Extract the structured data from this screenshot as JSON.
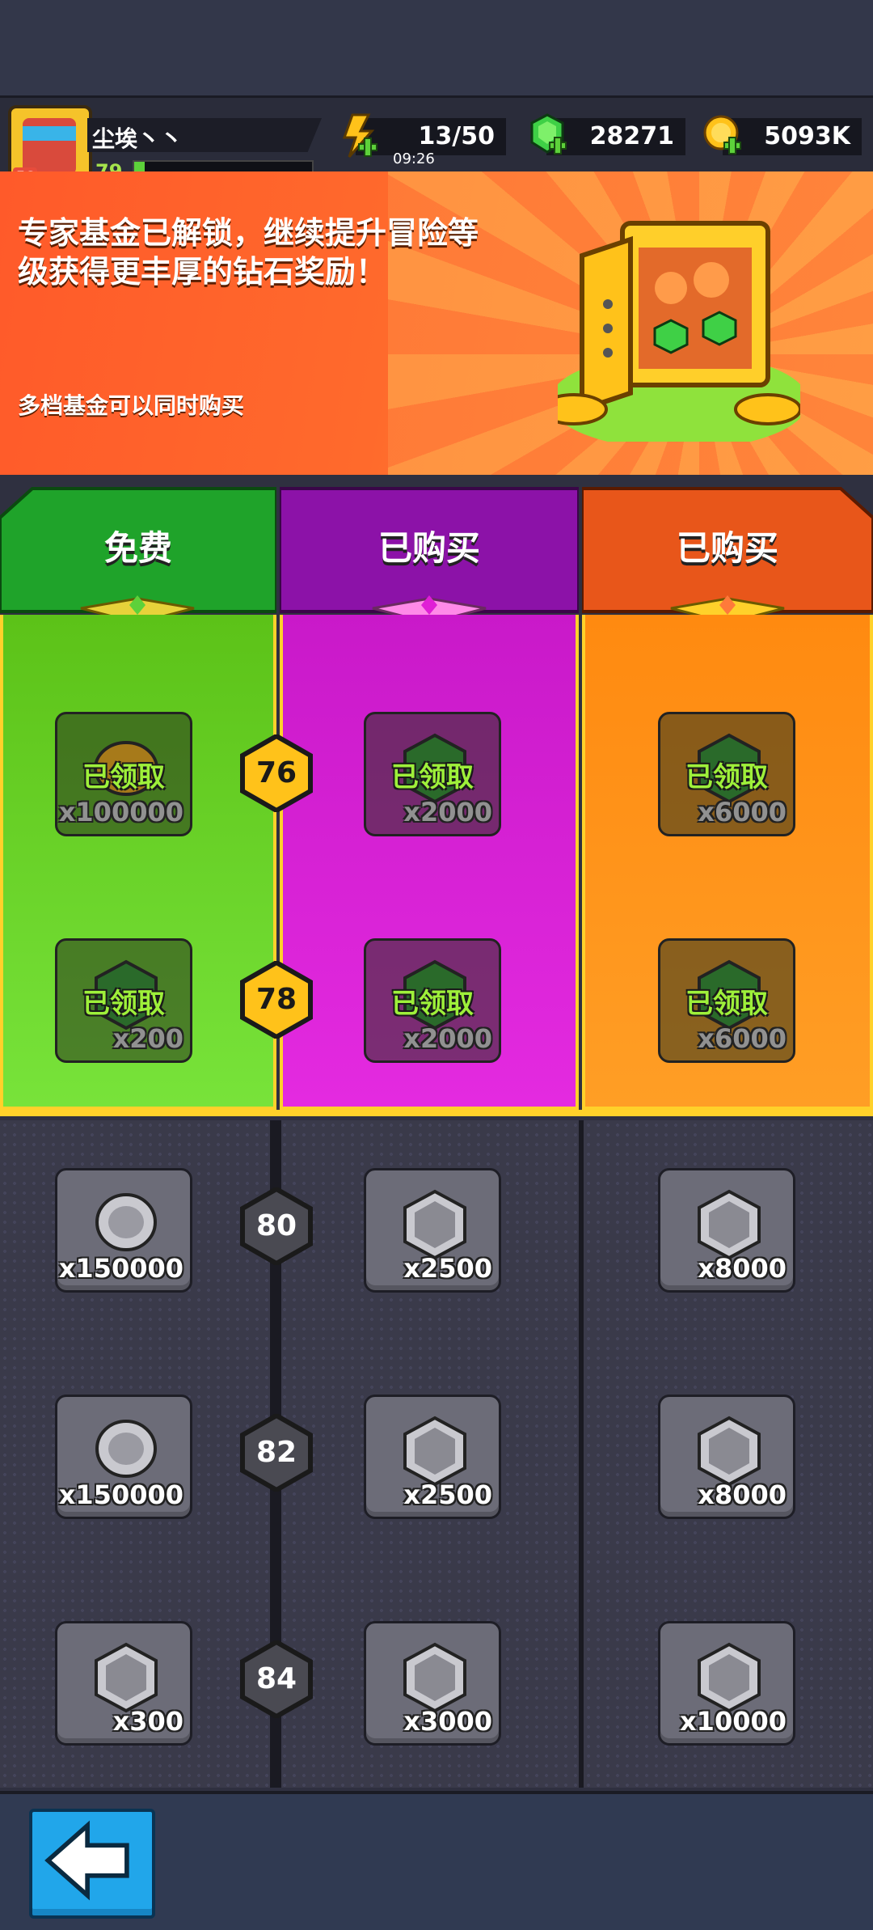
{
  "player": {
    "name": "尘埃丶丶",
    "avatar_badge": "56",
    "level": "79",
    "xp_fraction": 0.06
  },
  "resources": {
    "energy": "13/50",
    "energy_timer": "09:26",
    "gems": "28271",
    "gold": "5093K"
  },
  "banner": {
    "title": "专家基金已解锁，继续提升冒险等级获得更丰厚的钻石奖励！",
    "subtitle": "多档基金可以同时购买"
  },
  "columns": {
    "free": "免费",
    "tier2": "已购买",
    "tier3": "已购买"
  },
  "claim_label": "已领取",
  "rows": [
    {
      "level": "76",
      "free": "x100000",
      "tier2": "x2000",
      "tier3": "x6000"
    },
    {
      "level": "78",
      "free": "x200",
      "tier2": "x2000",
      "tier3": "x6000"
    },
    {
      "level": "80",
      "free": "x150000",
      "tier2": "x2500",
      "tier3": "x8000"
    },
    {
      "level": "82",
      "free": "x150000",
      "tier2": "x2500",
      "tier3": "x8000"
    },
    {
      "level": "84",
      "free": "x300",
      "tier2": "x3000",
      "tier3": "x10000"
    }
  ],
  "colors": {
    "free": "#46b81c",
    "tier2": "#c617c8",
    "tier3": "#ff8a10",
    "accent": "#ffd12a"
  }
}
